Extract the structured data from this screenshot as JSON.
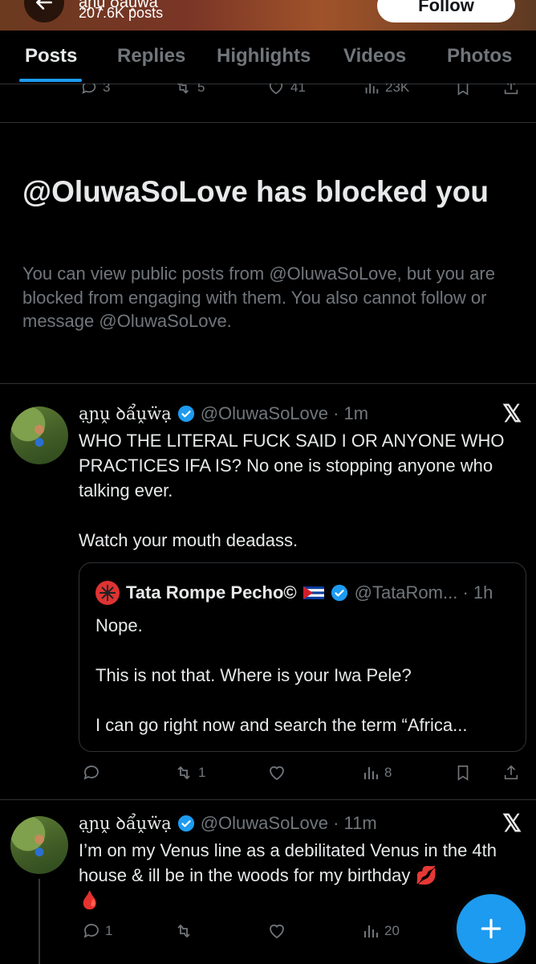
{
  "profile_header": {
    "name": "ạɲṷ ꝺẩṷẅạ",
    "posts_count": "207.6K posts",
    "follow_label": "Follow"
  },
  "tabs": [
    {
      "label": "Posts",
      "active": true
    },
    {
      "label": "Replies",
      "active": false
    },
    {
      "label": "Highlights",
      "active": false
    },
    {
      "label": "Videos",
      "active": false
    },
    {
      "label": "Photos",
      "active": false
    }
  ],
  "cut_post_actions": {
    "replies": "3",
    "reposts": "5",
    "likes": "41",
    "views": "23K"
  },
  "blocked_notice": {
    "title": "@OluwaSoLove has blocked you",
    "message": "You can view public posts from @OluwaSoLove, but you are blocked from engaging with them. You also cannot follow or message @OluwaSoLove."
  },
  "posts": [
    {
      "display_name": "ạɲṷ ꝺẩṷẅạ",
      "handle_time": "@OluwaSoLove · 1m",
      "text": "WHO THE LITERAL FUCK SAID I OR ANYONE WHO PRACTICES IFA IS? No one is stopping anyone who talking ever.\n\nWatch your mouth deadass.",
      "quote": {
        "name": "Tata Rompe Pecho©",
        "handle_time": "@TataRom... · 1h",
        "text": "Nope.\n\nThis is not that. Where is your Iwa Pele?\n\nI can go right now and search the term “Africa..."
      },
      "actions": {
        "replies": "",
        "reposts": "1",
        "likes": "",
        "views": "8"
      }
    },
    {
      "display_name": "ạɲṷ ꝺẩṷẅạ",
      "handle_time": "@OluwaSoLove · 11m",
      "text": "I’m on my Venus line as a debilitated Venus in the 4th house & ill be in the woods for my birthday 💋\n🩸",
      "actions": {
        "replies": "1",
        "reposts": "",
        "likes": "",
        "views": "20"
      }
    }
  ],
  "colors": {
    "accent": "#1d9bf0",
    "background": "#000000",
    "muted": "#71767b",
    "text": "#e7e9ea"
  }
}
